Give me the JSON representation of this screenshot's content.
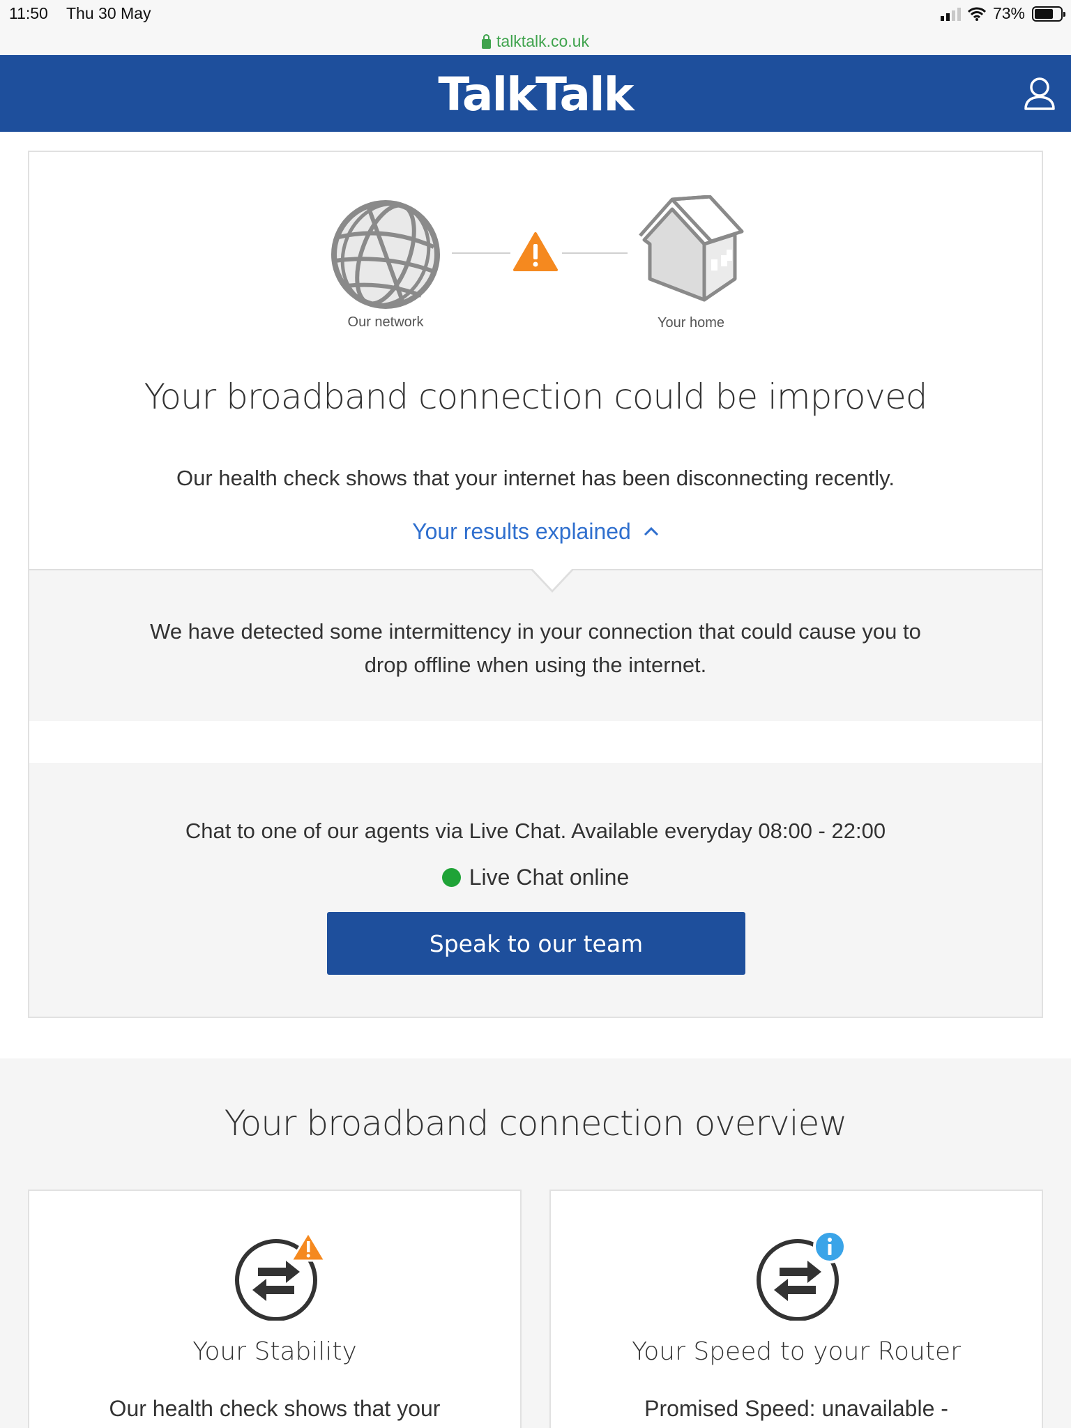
{
  "status_bar": {
    "time": "11:50",
    "date": "Thu 30 May",
    "battery": "73%",
    "battery_level": 0.73
  },
  "url_bar": {
    "domain": "talktalk.co.uk"
  },
  "header": {
    "logo": "TalkTalk"
  },
  "diagram": {
    "network_label": "Our network",
    "home_label": "Your home"
  },
  "main": {
    "title": "Your broadband connection could be improved",
    "subtitle": "Our health check shows that your internet has been disconnecting recently.",
    "results_link": "Your results explained",
    "explanation_line1": "We have detected some intermittency in your connection that could cause you to",
    "explanation_line2": "drop offline when using the internet."
  },
  "chat": {
    "text": "Chat to one of our agents via Live Chat. Available everyday 08:00 - 22:00",
    "status": "Live Chat online",
    "button": "Speak to our team"
  },
  "overview": {
    "title": "Your broadband connection overview",
    "tiles": [
      {
        "title": "Your Stability",
        "text": "Our health check shows that your"
      },
      {
        "title": "Your Speed to your Router",
        "text": "Promised Speed: unavailable -"
      }
    ]
  },
  "colors": {
    "brand_blue": "#1e4f9c",
    "link_blue": "#2f6fce",
    "warning_orange": "#f5891f",
    "info_blue": "#3aa4e8",
    "online_green": "#1fa337",
    "secure_green": "#3fa34d"
  }
}
